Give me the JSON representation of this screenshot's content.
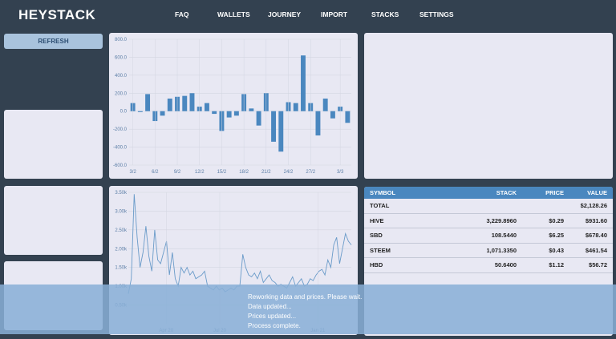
{
  "app": {
    "title": "HEYSTACK"
  },
  "nav": {
    "items": [
      "FAQ",
      "WALLETS",
      "JOURNEY",
      "IMPORT",
      "STACKS",
      "SETTINGS"
    ]
  },
  "sidebar": {
    "refresh_label": "REFRESH"
  },
  "chart_data": [
    {
      "type": "bar",
      "title": "",
      "xlabel": "",
      "ylabel": "",
      "ylim": [
        -600,
        800
      ],
      "y_ticks": [
        "800.0",
        "600.0",
        "400.0",
        "200.0",
        "0.0",
        "-200.0",
        "-400.0",
        "-600.0"
      ],
      "x_tick_labels": [
        "3/2",
        "6/2",
        "9/2",
        "12/2",
        "15/2",
        "18/2",
        "21/2",
        "24/2",
        "27/2",
        "3/3"
      ],
      "color": "#4a87bf",
      "values": [
        90,
        -10,
        190,
        -110,
        -50,
        140,
        160,
        170,
        200,
        50,
        90,
        -30,
        -220,
        -70,
        -50,
        190,
        30,
        -160,
        200,
        -340,
        -450,
        100,
        90,
        620,
        90,
        -270,
        140,
        -80,
        50,
        -130
      ]
    },
    {
      "type": "line",
      "title": "",
      "xlabel": "",
      "ylabel": "",
      "ylim": [
        0,
        3500
      ],
      "y_ticks": [
        "3.50k",
        "3.00k",
        "2.50k",
        "2.00k",
        "1.50k",
        "1.00k",
        "0.50k"
      ],
      "x_tick_labels": [
        "Apr 20",
        "Jul 20",
        "Jan 21"
      ],
      "color": "#6a9bc9",
      "values": [
        800,
        1200,
        3450,
        2300,
        1500,
        1900,
        2600,
        1800,
        1400,
        2500,
        1700,
        1600,
        1900,
        2200,
        1300,
        1900,
        1200,
        1000,
        1500,
        1350,
        1500,
        1300,
        1400,
        1200,
        1250,
        1300,
        1400,
        1000,
        950,
        900,
        1000,
        900,
        950,
        850,
        900,
        950,
        900,
        1000,
        1000,
        1850,
        1500,
        1300,
        1250,
        1350,
        1200,
        1400,
        1100,
        1200,
        1300,
        1150,
        1100,
        1000,
        1050,
        1000,
        950,
        1100,
        1250,
        1000,
        1100,
        1200,
        1000,
        1050,
        1200,
        1150,
        1300,
        1400,
        1450,
        1300,
        1700,
        1500,
        2100,
        2300,
        1600,
        2000,
        2400,
        2200,
        2100
      ]
    }
  ],
  "holdings_table": {
    "headers": [
      "SYMBOL",
      "STACK",
      "PRICE",
      "VALUE"
    ],
    "total_label": "TOTAL",
    "total_value": "$2,128.26",
    "rows": [
      {
        "symbol": "HIVE",
        "stack": "3,229.8960",
        "price": "$0.29",
        "value": "$931.60"
      },
      {
        "symbol": "SBD",
        "stack": "108.5440",
        "price": "$6.25",
        "value": "$678.40"
      },
      {
        "symbol": "STEEM",
        "stack": "1,071.3350",
        "price": "$0.43",
        "value": "$461.54"
      },
      {
        "symbol": "HBD",
        "stack": "50.6400",
        "price": "$1.12",
        "value": "$56.72"
      }
    ]
  },
  "status_log": [
    "Reworking data and prices. Please wait.",
    "Data updated...",
    "Prices updated...",
    "Process complete."
  ]
}
